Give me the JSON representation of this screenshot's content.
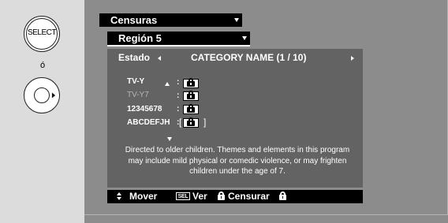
{
  "remote": {
    "select_label": "SELECT",
    "or_label": "ó"
  },
  "menu": {
    "dropdown1_label": "Censuras",
    "dropdown2_label": "Región 5"
  },
  "panel": {
    "estado_label": "Estado",
    "category_title": "CATEGORY NAME (1 / 10)",
    "ratings": [
      {
        "label": "TV-Y",
        "locked": true
      },
      {
        "label": "TV-Y7",
        "locked": true
      },
      {
        "label": "12345678",
        "locked": true
      },
      {
        "label": "ABCDEFJH",
        "locked": true
      }
    ],
    "colon": ":",
    "bracket_open": "[",
    "bracket_close": "]",
    "description": "Directed to older children. Themes and elements in this program may include mild physical or comedic violence, or may frighten children under the age of 7."
  },
  "help_bar": {
    "mover_label": "Mover",
    "sel_label": "SEL",
    "ver_label": "Ver",
    "censurar_label": "Censurar"
  },
  "colors": {
    "screen_bg": "#8c8c8c",
    "panel_bg": "#636363",
    "bar_bg": "#000000",
    "text": "#ffffff"
  }
}
